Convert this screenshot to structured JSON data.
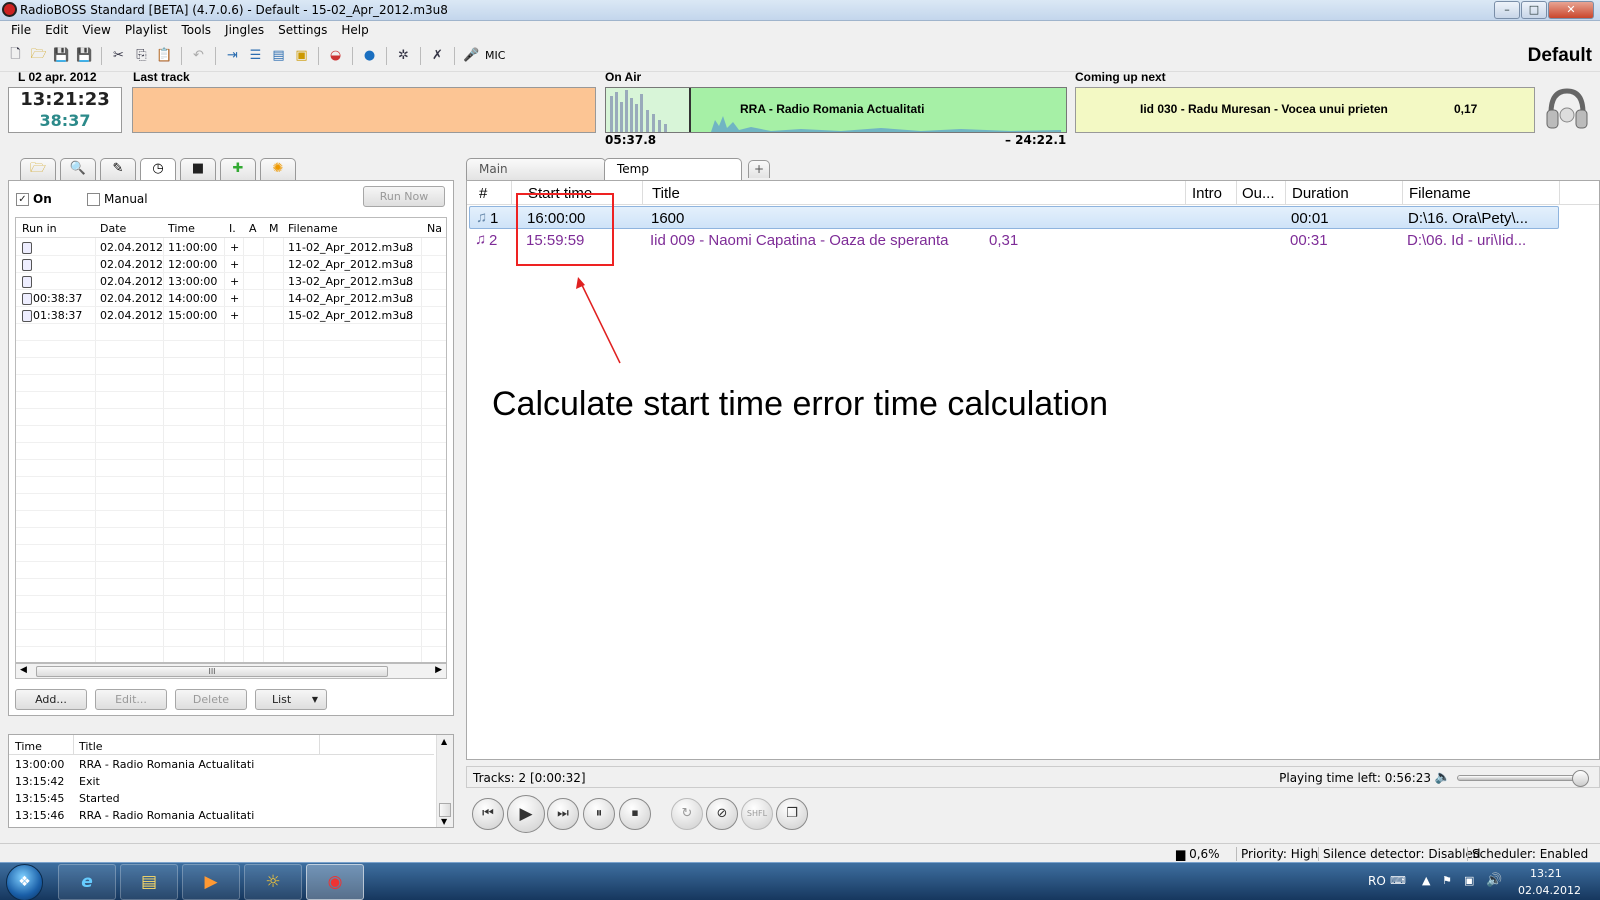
{
  "window": {
    "title": "RadioBOSS Standard [BETA] (4.7.0.6) - Default - 15-02_Apr_2012.m3u8",
    "min": "–",
    "max": "□",
    "close": "✕"
  },
  "menu": [
    "File",
    "Edit",
    "View",
    "Playlist",
    "Tools",
    "Jingles",
    "Settings",
    "Help"
  ],
  "toolbar": {
    "mic_label": "MIC",
    "profile": "Default"
  },
  "clock": {
    "date": "L 02 apr. 2012",
    "time": "13:21:23",
    "remaining": "38:37"
  },
  "last_track": {
    "label": "Last track"
  },
  "on_air": {
    "label": "On Air",
    "title": "RRA - Radio Romania Actualitati",
    "elapsed": "05:37.8",
    "remaining": "– 24:22.1"
  },
  "coming_up": {
    "label": "Coming up next",
    "title": "Iid 030 - Radu Muresan - Vocea unui prieten",
    "duration": "0,17"
  },
  "scheduler": {
    "on_label": "On",
    "on_checked": true,
    "manual_label": "Manual",
    "manual_checked": false,
    "run_now": "Run Now",
    "columns": [
      "Run in",
      "Date",
      "Time",
      "I.",
      "A",
      "M",
      "Filename",
      "Na"
    ],
    "rows": [
      {
        "run_in": "",
        "date": "02.04.2012",
        "time": "11:00:00",
        "i": "+",
        "file": "11-02_Apr_2012.m3u8",
        "more": "..."
      },
      {
        "run_in": "",
        "date": "02.04.2012",
        "time": "12:00:00",
        "i": "+",
        "file": "12-02_Apr_2012.m3u8",
        "more": "..."
      },
      {
        "run_in": "",
        "date": "02.04.2012",
        "time": "13:00:00",
        "i": "+",
        "file": "13-02_Apr_2012.m3u8",
        "more": "..."
      },
      {
        "run_in": "00:38:37",
        "date": "02.04.2012",
        "time": "14:00:00",
        "i": "+",
        "file": "14-02_Apr_2012.m3u8",
        "more": "..."
      },
      {
        "run_in": "01:38:37",
        "date": "02.04.2012",
        "time": "15:00:00",
        "i": "+",
        "file": "15-02_Apr_2012.m3u8",
        "more": "..."
      }
    ],
    "scroll_grip": "III",
    "buttons": {
      "add": "Add...",
      "edit": "Edit...",
      "delete": "Delete",
      "list": "List"
    }
  },
  "log": {
    "columns": [
      "Time",
      "Title"
    ],
    "rows": [
      {
        "time": "13:00:00",
        "title": "RRA - Radio Romania Actualitati"
      },
      {
        "time": "13:15:42",
        "title": "Exit"
      },
      {
        "time": "13:15:45",
        "title": "Started"
      },
      {
        "time": "13:15:46",
        "title": "RRA - Radio Romania Actualitati"
      }
    ]
  },
  "playlist": {
    "tabs": [
      "Main",
      "Temp"
    ],
    "active_tab": "Temp",
    "columns": [
      "#",
      "Start time",
      "Title",
      "Intro",
      "Ou...",
      "Duration",
      "Filename"
    ],
    "rows": [
      {
        "num": "1",
        "start": "16:00:00",
        "title": "1600",
        "extra": "",
        "duration": "00:01",
        "file": "D:\\16. Ora\\Pety\\...",
        "selected": true
      },
      {
        "num": "2",
        "start": "15:59:59",
        "title": "Iid 009 - Naomi Capatina - Oaza de speranta",
        "extra": "0,31",
        "duration": "00:31",
        "file": "D:\\06. Id - uri\\Iid...",
        "selected": false
      }
    ],
    "tracks": "Tracks: 2 [0:00:32]",
    "playing_time_left": "Playing time left: 0:56:23",
    "volume_level": 1.0
  },
  "annotation": {
    "text": "Calculate start time error time calculation",
    "color": "#e02020"
  },
  "statusbar": {
    "cpu": "0,6%",
    "priority": "Priority: High",
    "silence": "Silence detector: Disabled",
    "scheduler": "Scheduler: Enabled"
  },
  "taskbar": {
    "lang": "RO",
    "clock_time": "13:21",
    "clock_date": "02.04.2012"
  }
}
